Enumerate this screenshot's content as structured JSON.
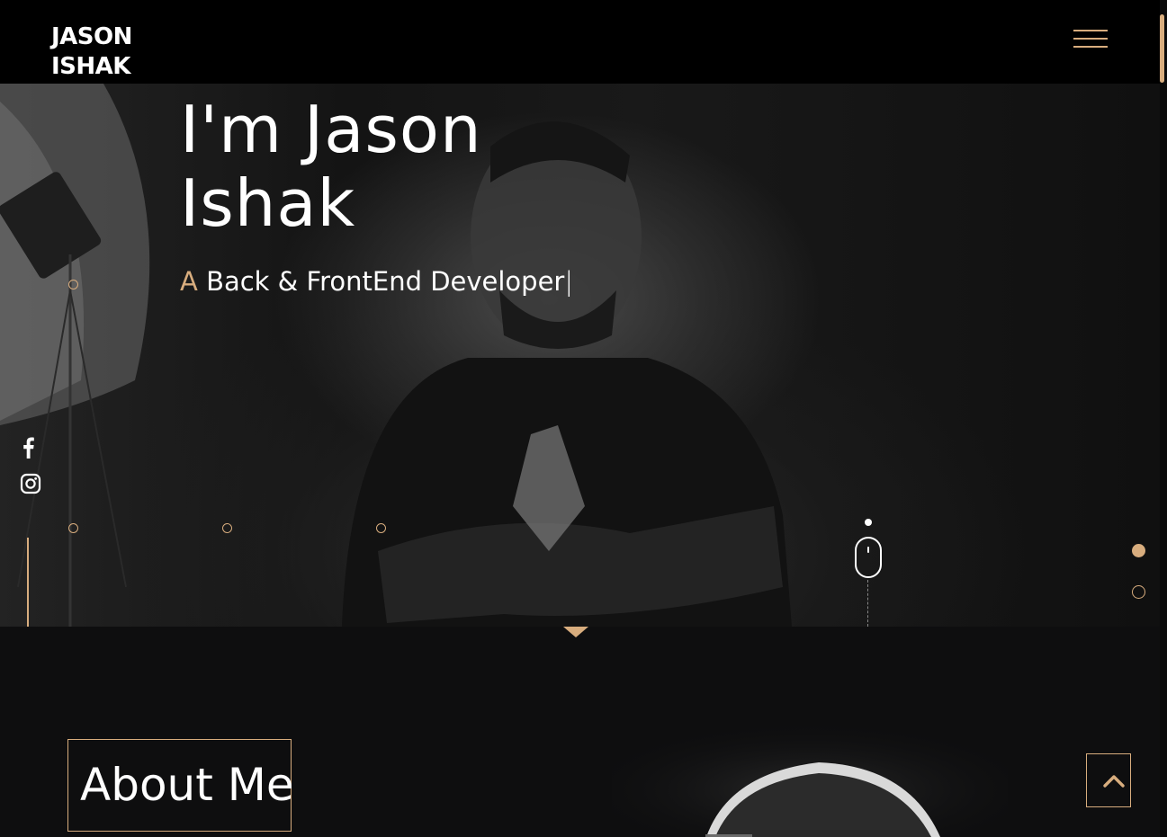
{
  "header": {
    "logo_line1": "JASON",
    "logo_line2": "ISHAK",
    "menu_icon": "hamburger-menu-icon"
  },
  "hero": {
    "title_line1": "I'm Jason",
    "title_line2": "Ishak",
    "subtitle_prefix": "A",
    "subtitle_text": "Back & FrontEnd Developer",
    "cursor": "|",
    "social": [
      {
        "icon": "facebook-icon"
      },
      {
        "icon": "instagram-icon"
      }
    ],
    "scroll_indicator_icon": "mouse-scroll-icon",
    "slide_count": 2,
    "active_slide": 1
  },
  "about": {
    "title": "About Me"
  },
  "back_to_top_icon": "chevron-up-icon",
  "colors": {
    "accent": "#d8ad7e",
    "header_bg": "#000000",
    "page_bg": "#0e0e0f",
    "text": "#ffffff"
  }
}
